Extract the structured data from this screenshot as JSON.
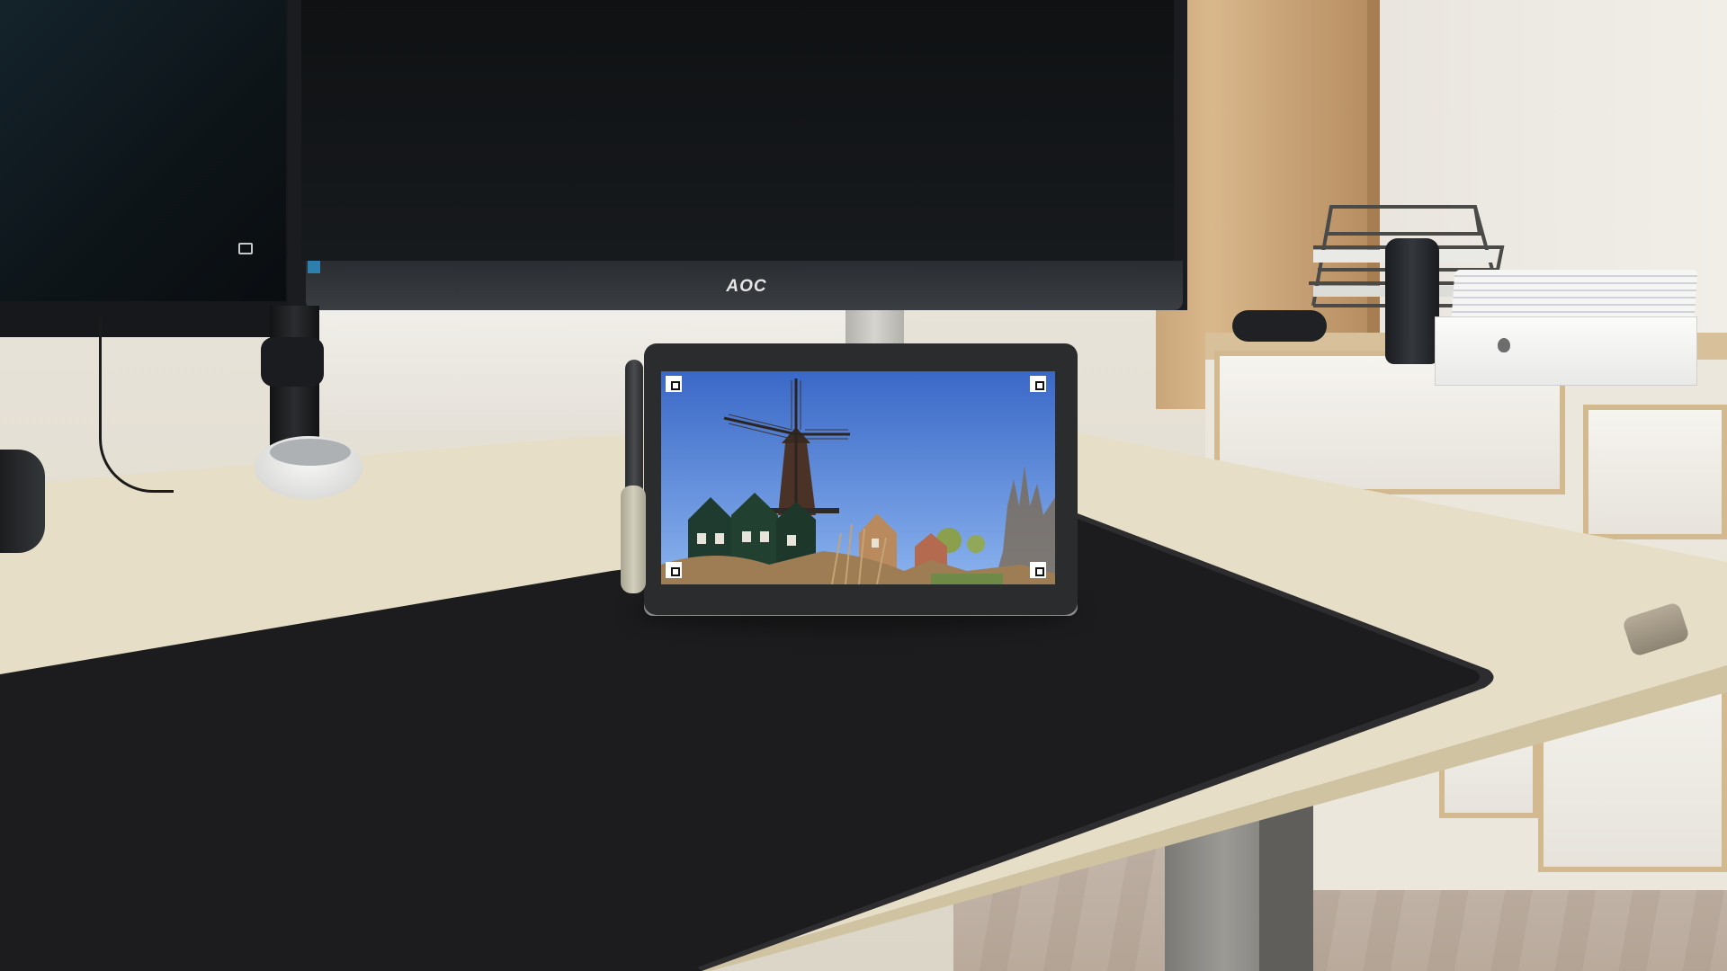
{
  "scene": {
    "description_tags": [
      "desk",
      "tablet",
      "monitors",
      "windmill-photo"
    ]
  },
  "monitor": {
    "brand_label": "AOC"
  },
  "tablet": {
    "photo_subject_icon": "windmill-icon",
    "corner_markers": [
      "tl",
      "tr",
      "bl",
      "br"
    ]
  },
  "colors": {
    "sky_top": "#3a68c7",
    "sky_bottom": "#8bb3ee",
    "desk_mat": "#1c1c1e",
    "desk_top": "#e4dcc3",
    "wood_cabinet": "#d2b083"
  }
}
